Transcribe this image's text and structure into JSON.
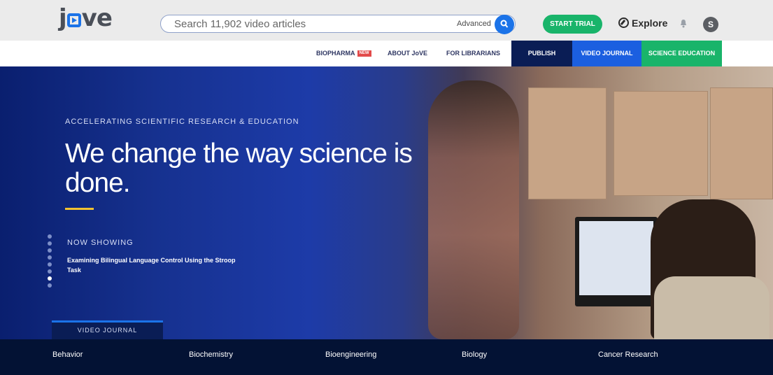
{
  "header": {
    "logo_text": "jove",
    "search": {
      "placeholder": "Search 11,902 video articles",
      "advanced_label": "Advanced"
    },
    "start_trial_label": "START TRIAL",
    "explore_label": "Explore",
    "avatar_initial": "S"
  },
  "nav": {
    "items": [
      {
        "label": "BIOPHARMA",
        "badge": "NEW"
      },
      {
        "label": "ABOUT JoVE"
      },
      {
        "label": "FOR LIBRARIANS"
      }
    ],
    "blocks": [
      {
        "label": "PUBLISH",
        "color": "#0a1d55"
      },
      {
        "label": "VIDEO JOURNAL",
        "color": "#1b5fe0"
      },
      {
        "label": "SCIENCE EDUCATION",
        "color": "#19b46a"
      }
    ]
  },
  "hero": {
    "kicker": "ACCELERATING SCIENTIFIC RESEARCH & EDUCATION",
    "headline": "We change the way science is done.",
    "now_showing_label": "NOW SHOWING",
    "now_showing_title": "Examining Bilingual Language Control Using the Stroop Task",
    "slide_count": 8,
    "active_slide": 7,
    "section_tab": "VIDEO JOURNAL"
  },
  "categories": {
    "row1": [
      "Behavior",
      "Biochemistry",
      "Bioengineering",
      "Biology",
      "Cancer Research"
    ]
  },
  "colors": {
    "brand_blue": "#1b73e8",
    "trial_green": "#19b46a",
    "accent_yellow": "#f2c230",
    "dark_navy": "#031234"
  }
}
